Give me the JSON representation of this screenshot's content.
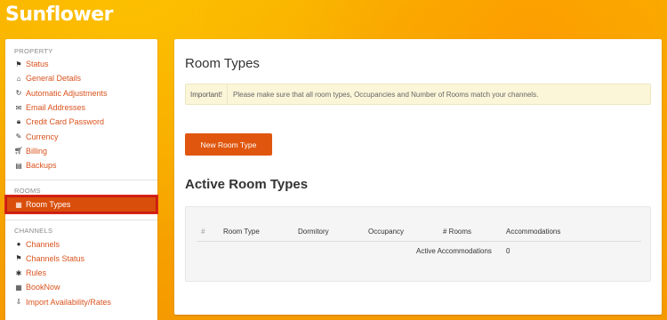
{
  "brand": "Sunflower",
  "sidebar": {
    "sections": [
      {
        "title": "PROPERTY",
        "items": [
          {
            "icon": "⚑",
            "label": "Status"
          },
          {
            "icon": "⌂",
            "label": "General Details"
          },
          {
            "icon": "↻",
            "label": "Automatic Adjustments"
          },
          {
            "icon": "✉",
            "label": "Email Addresses"
          },
          {
            "icon": "🔒︎",
            "label": "Credit Card Password"
          },
          {
            "icon": "✎",
            "label": "Currency"
          },
          {
            "icon": "🛒︎",
            "label": "Billing"
          },
          {
            "icon": "▤",
            "label": "Backups"
          }
        ]
      },
      {
        "title": "ROOMS",
        "items": [
          {
            "icon": "▦",
            "label": "Room Types"
          }
        ]
      },
      {
        "title": "CHANNELS",
        "items": [
          {
            "icon": "●",
            "label": "Channels"
          },
          {
            "icon": "⚑",
            "label": "Channels Status"
          },
          {
            "icon": "✱",
            "label": "Rules"
          },
          {
            "icon": "▦",
            "label": "BookNow"
          },
          {
            "icon": "⇩",
            "label": "Import Availability/Rates"
          }
        ]
      }
    ]
  },
  "main": {
    "title": "Room Types",
    "alert": {
      "label": "Important!",
      "text": "Please make sure that all room types, Occupancies and Number of Rooms match your channels."
    },
    "new_button": "New Room Type",
    "section_title": "Active Room Types",
    "table": {
      "headers": [
        "#",
        "Room Type",
        "Dormitory",
        "Occupancy",
        "# Rooms",
        "Accommodations"
      ],
      "summary_label": "Active Accommodations",
      "summary_value": "0"
    }
  },
  "colors": {
    "accent": "#e0560e",
    "link": "#d9531e",
    "background": "#f7a600"
  }
}
